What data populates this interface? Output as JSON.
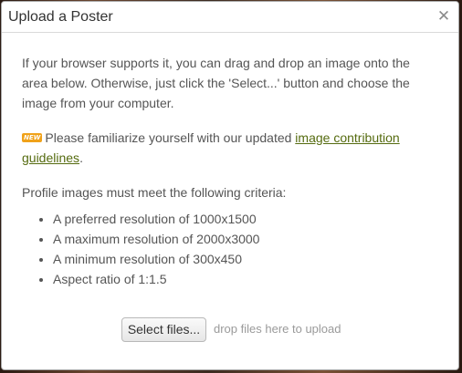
{
  "dialog": {
    "title": "Upload a Poster",
    "close_icon": "close-icon"
  },
  "intro": {
    "text": "If your browser supports it, you can drag and drop an image onto the area below. Otherwise, just click the 'Select...' button and choose the image from your computer."
  },
  "notice": {
    "badge": "NEW",
    "text_before": "Please familiarize yourself with our updated ",
    "link_text": "image contribution guidelines",
    "text_after": "."
  },
  "criteria": {
    "heading": "Profile images must meet the following criteria:",
    "items": [
      "A preferred resolution of 1000x1500",
      "A maximum resolution of 2000x3000",
      "A minimum resolution of 300x450",
      "Aspect ratio of 1:1.5"
    ]
  },
  "upload": {
    "select_button": "Select files...",
    "drop_hint": "drop files here to upload"
  }
}
